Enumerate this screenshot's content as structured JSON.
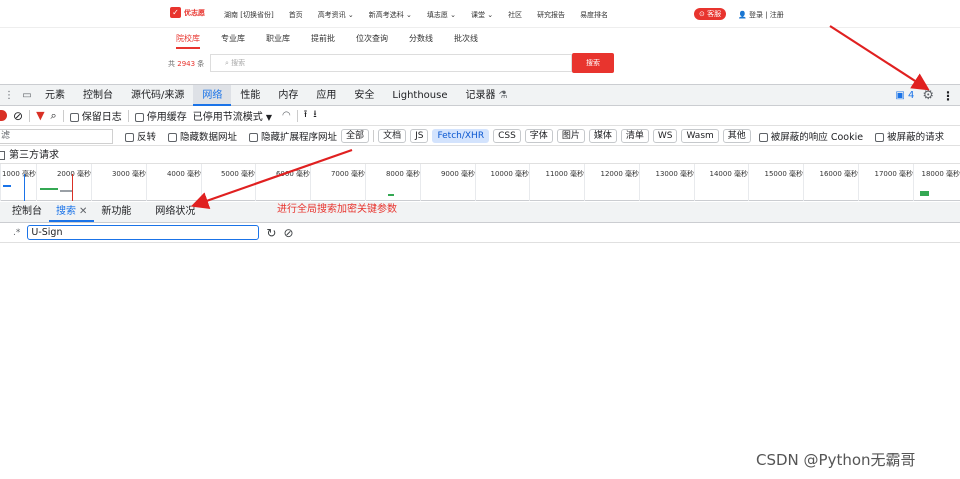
{
  "site": {
    "logo": "优志愿",
    "nav": [
      "湖南 [切换省份]",
      "首页",
      "高考资讯 ⌄",
      "新高考选科 ⌄",
      "填志愿 ⌄",
      "课堂 ⌄",
      "社区",
      "研究报告",
      "易度排名"
    ],
    "kefu": "客服",
    "login": "登录 | 注册",
    "tabs": [
      "院校库",
      "专业库",
      "职业库",
      "提前批",
      "位次查询",
      "分数线",
      "批次线"
    ],
    "count_prefix": "共",
    "count_value": "2943",
    "count_suffix": "条",
    "search_placeholder": "搜索",
    "search_button": "搜索"
  },
  "devtools": {
    "tabs": [
      "元素",
      "控制台",
      "源代码/来源",
      "网络",
      "性能",
      "内存",
      "应用",
      "安全",
      "Lighthouse",
      "记录器"
    ],
    "active_tab": "网络",
    "issues_count": "4",
    "toolbar": {
      "preserve_log": "保留日志",
      "disable_cache": "停用缓存",
      "throttle": "已停用节流模式"
    },
    "filter": {
      "placeholder": "滤",
      "invert": "反转",
      "hide_data_urls": "隐藏数据网址",
      "hide_ext_urls": "隐藏扩展程序网址",
      "types": [
        "全部",
        "文档",
        "JS",
        "Fetch/XHR",
        "CSS",
        "字体",
        "图片",
        "媒体",
        "清单",
        "WS",
        "Wasm",
        "其他"
      ],
      "active_type": "Fetch/XHR",
      "blocked_cookies": "被屏蔽的响应 Cookie",
      "blocked_requests": "被屏蔽的请求"
    },
    "third_party": "第三方请求",
    "timeline_ticks": [
      "1000 毫秒",
      "2000 毫秒",
      "3000 毫秒",
      "4000 毫秒",
      "5000 毫秒",
      "6000 毫秒",
      "7000 毫秒",
      "8000 毫秒",
      "9000 毫秒",
      "10000 毫秒",
      "11000 毫秒",
      "12000 毫秒",
      "13000 毫秒",
      "14000 毫秒",
      "15000 毫秒",
      "16000 毫秒",
      "17000 毫秒",
      "18000 毫秒"
    ],
    "drawer_tabs": [
      "控制台",
      "搜索",
      "新功能",
      "网络状况"
    ],
    "active_drawer_tab": "搜索",
    "search_value": "U-Sign",
    "regex_label": ".*"
  },
  "annotation": "进行全局搜索加密关键参数",
  "watermark": "CSDN @Python无霸哥",
  "colors": {
    "accent": "#1a73e8",
    "brand": "#e8342e",
    "arrow": "#e02020"
  }
}
